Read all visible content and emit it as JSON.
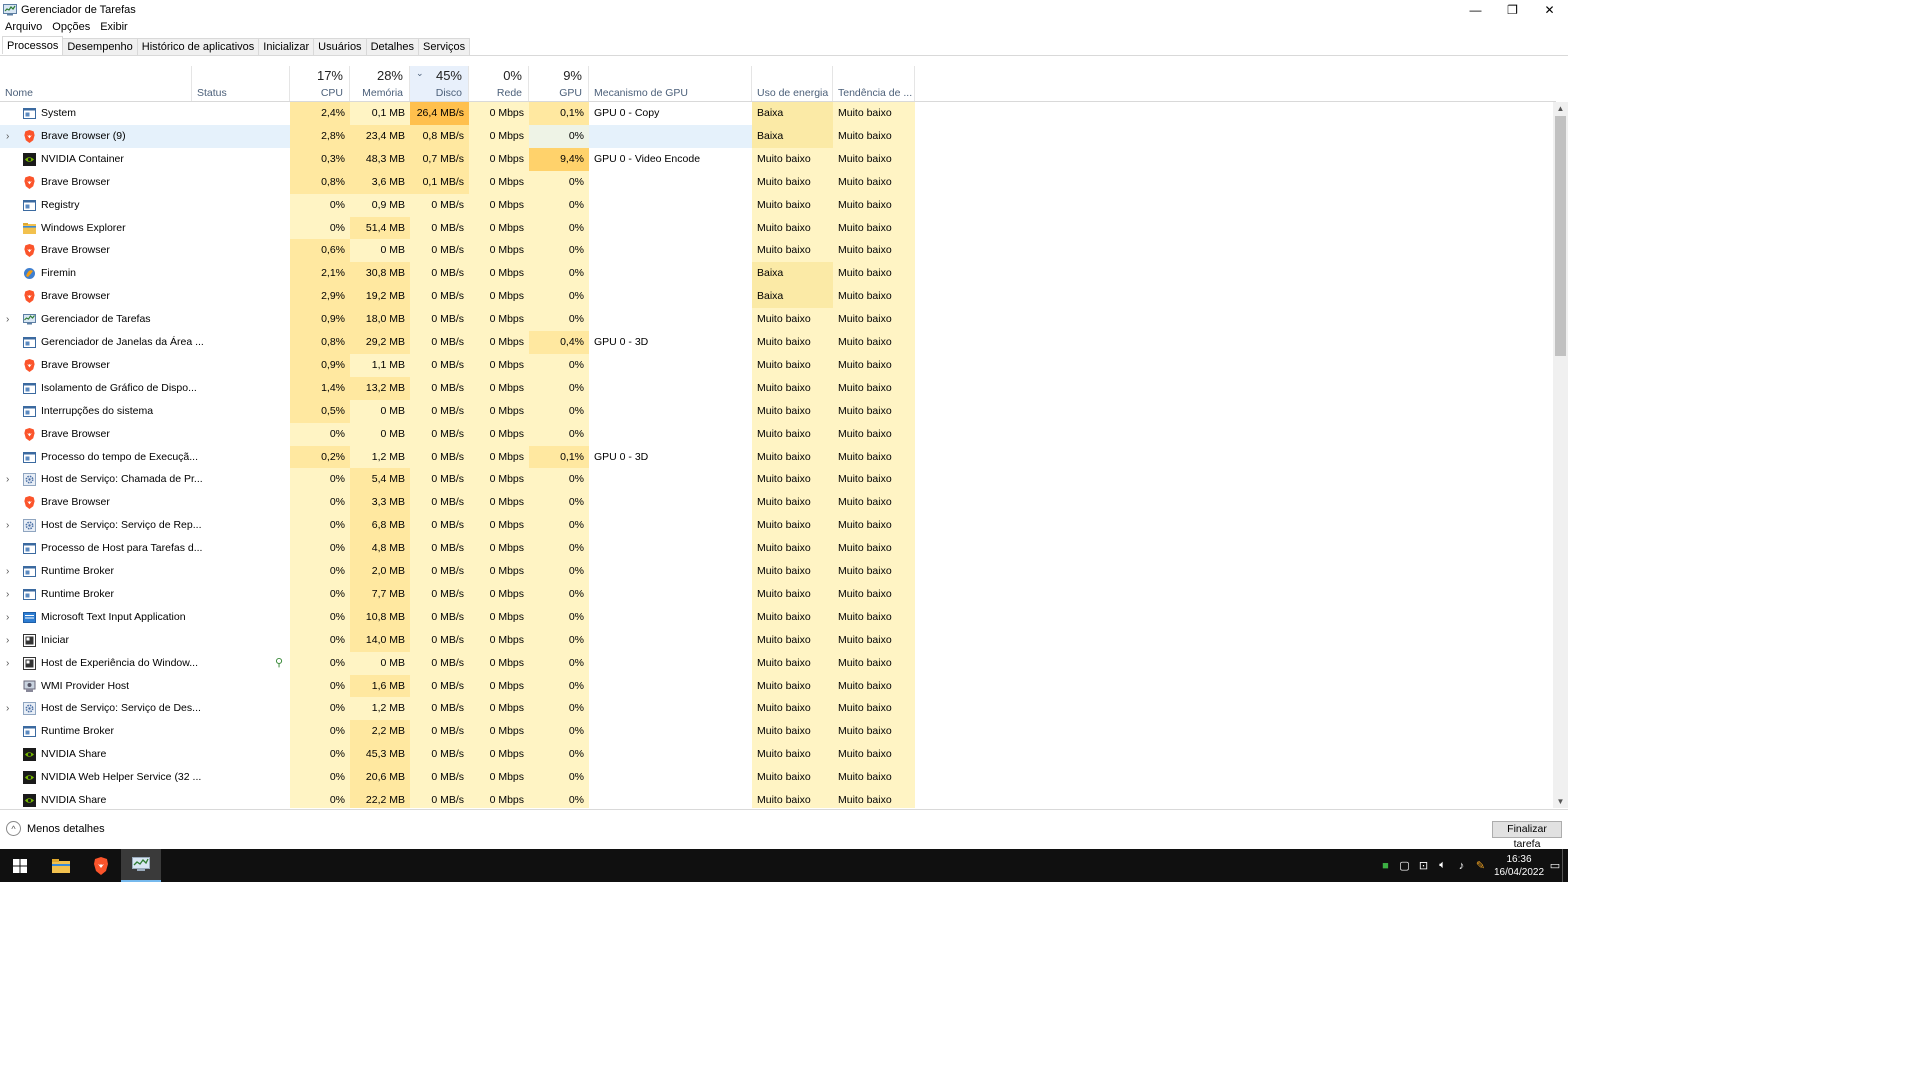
{
  "window": {
    "title": "Gerenciador de Tarefas",
    "minimize": "—",
    "restore": "❐",
    "close": "✕"
  },
  "menu": [
    "Arquivo",
    "Opções",
    "Exibir"
  ],
  "tabs": [
    "Processos",
    "Desempenho",
    "Histórico de aplicativos",
    "Inicializar",
    "Usuários",
    "Detalhes",
    "Serviços"
  ],
  "header": {
    "name": "Nome",
    "status": "Status",
    "cpu_pct": "17%",
    "cpu": "CPU",
    "mem_pct": "28%",
    "mem": "Memória",
    "disk_pct": "45%",
    "disk": "Disco",
    "net_pct": "0%",
    "net": "Rede",
    "gpu_pct": "9%",
    "gpu": "GPU",
    "gpu_engine": "Mecanismo de GPU",
    "power": "Uso de energia",
    "power_trend": "Tendência de ..."
  },
  "rows": [
    {
      "name": "System",
      "icon": "system-icon",
      "exp": false,
      "cpu": "2,4%",
      "mem": "0,1 MB",
      "disk": "26,4 MB/s",
      "net": "0 Mbps",
      "gpu": "0,1%",
      "eng": "GPU 0 - Copy",
      "pow": "Baixa",
      "trend": "Muito baixo"
    },
    {
      "name": "Brave Browser (9)",
      "icon": "brave-icon",
      "exp": true,
      "cpu": "2,8%",
      "mem": "23,4 MB",
      "disk": "0,8 MB/s",
      "net": "0 Mbps",
      "gpu": "0%",
      "eng": "",
      "pow": "Baixa",
      "trend": "Muito baixo"
    },
    {
      "name": "NVIDIA Container",
      "icon": "nvidia-icon",
      "exp": false,
      "cpu": "0,3%",
      "mem": "48,3 MB",
      "disk": "0,7 MB/s",
      "net": "0 Mbps",
      "gpu": "9,4%",
      "eng": "GPU 0 - Video Encode",
      "pow": "Muito baixo",
      "trend": "Muito baixo"
    },
    {
      "name": "Brave Browser",
      "icon": "brave-icon",
      "exp": false,
      "cpu": "0,8%",
      "mem": "3,6 MB",
      "disk": "0,1 MB/s",
      "net": "0 Mbps",
      "gpu": "0%",
      "eng": "",
      "pow": "Muito baixo",
      "trend": "Muito baixo"
    },
    {
      "name": "Registry",
      "icon": "system-icon",
      "exp": false,
      "cpu": "0%",
      "mem": "0,9 MB",
      "disk": "0 MB/s",
      "net": "0 Mbps",
      "gpu": "0%",
      "eng": "",
      "pow": "Muito baixo",
      "trend": "Muito baixo"
    },
    {
      "name": "Windows Explorer",
      "icon": "explorer-icon",
      "exp": false,
      "cpu": "0%",
      "mem": "51,4 MB",
      "disk": "0 MB/s",
      "net": "0 Mbps",
      "gpu": "0%",
      "eng": "",
      "pow": "Muito baixo",
      "trend": "Muito baixo"
    },
    {
      "name": "Brave Browser",
      "icon": "brave-icon",
      "exp": false,
      "cpu": "0,6%",
      "mem": "0 MB",
      "disk": "0 MB/s",
      "net": "0 Mbps",
      "gpu": "0%",
      "eng": "",
      "pow": "Muito baixo",
      "trend": "Muito baixo"
    },
    {
      "name": "Firemin",
      "icon": "firemin-icon",
      "exp": false,
      "cpu": "2,1%",
      "mem": "30,8 MB",
      "disk": "0 MB/s",
      "net": "0 Mbps",
      "gpu": "0%",
      "eng": "",
      "pow": "Baixa",
      "trend": "Muito baixo"
    },
    {
      "name": "Brave Browser",
      "icon": "brave-icon",
      "exp": false,
      "cpu": "2,9%",
      "mem": "19,2 MB",
      "disk": "0 MB/s",
      "net": "0 Mbps",
      "gpu": "0%",
      "eng": "",
      "pow": "Baixa",
      "trend": "Muito baixo"
    },
    {
      "name": "Gerenciador de Tarefas",
      "icon": "task-manager-icon",
      "exp": true,
      "cpu": "0,9%",
      "mem": "18,0 MB",
      "disk": "0 MB/s",
      "net": "0 Mbps",
      "gpu": "0%",
      "eng": "",
      "pow": "Muito baixo",
      "trend": "Muito baixo"
    },
    {
      "name": "Gerenciador de Janelas da Área ...",
      "icon": "system-icon",
      "exp": false,
      "cpu": "0,8%",
      "mem": "29,2 MB",
      "disk": "0 MB/s",
      "net": "0 Mbps",
      "gpu": "0,4%",
      "eng": "GPU 0 - 3D",
      "pow": "Muito baixo",
      "trend": "Muito baixo"
    },
    {
      "name": "Brave Browser",
      "icon": "brave-icon",
      "exp": false,
      "cpu": "0,9%",
      "mem": "1,1 MB",
      "disk": "0 MB/s",
      "net": "0 Mbps",
      "gpu": "0%",
      "eng": "",
      "pow": "Muito baixo",
      "trend": "Muito baixo"
    },
    {
      "name": "Isolamento de Gráfico de Dispo...",
      "icon": "system-icon",
      "exp": false,
      "cpu": "1,4%",
      "mem": "13,2 MB",
      "disk": "0 MB/s",
      "net": "0 Mbps",
      "gpu": "0%",
      "eng": "",
      "pow": "Muito baixo",
      "trend": "Muito baixo"
    },
    {
      "name": "Interrupções do sistema",
      "icon": "system-icon",
      "exp": false,
      "cpu": "0,5%",
      "mem": "0 MB",
      "disk": "0 MB/s",
      "net": "0 Mbps",
      "gpu": "0%",
      "eng": "",
      "pow": "Muito baixo",
      "trend": "Muito baixo"
    },
    {
      "name": "Brave Browser",
      "icon": "brave-icon",
      "exp": false,
      "cpu": "0%",
      "mem": "0 MB",
      "disk": "0 MB/s",
      "net": "0 Mbps",
      "gpu": "0%",
      "eng": "",
      "pow": "Muito baixo",
      "trend": "Muito baixo"
    },
    {
      "name": "Processo do tempo de Execuçã...",
      "icon": "system-icon",
      "exp": false,
      "cpu": "0,2%",
      "mem": "1,2 MB",
      "disk": "0 MB/s",
      "net": "0 Mbps",
      "gpu": "0,1%",
      "eng": "GPU 0 - 3D",
      "pow": "Muito baixo",
      "trend": "Muito baixo"
    },
    {
      "name": "Host de Serviço: Chamada de Pr...",
      "icon": "gear-icon",
      "exp": true,
      "cpu": "0%",
      "mem": "5,4 MB",
      "disk": "0 MB/s",
      "net": "0 Mbps",
      "gpu": "0%",
      "eng": "",
      "pow": "Muito baixo",
      "trend": "Muito baixo"
    },
    {
      "name": "Brave Browser",
      "icon": "brave-icon",
      "exp": false,
      "cpu": "0%",
      "mem": "3,3 MB",
      "disk": "0 MB/s",
      "net": "0 Mbps",
      "gpu": "0%",
      "eng": "",
      "pow": "Muito baixo",
      "trend": "Muito baixo"
    },
    {
      "name": "Host de Serviço: Serviço de Rep...",
      "icon": "gear-icon",
      "exp": true,
      "cpu": "0%",
      "mem": "6,8 MB",
      "disk": "0 MB/s",
      "net": "0 Mbps",
      "gpu": "0%",
      "eng": "",
      "pow": "Muito baixo",
      "trend": "Muito baixo"
    },
    {
      "name": "Processo de Host para Tarefas d...",
      "icon": "system-icon",
      "exp": false,
      "cpu": "0%",
      "mem": "4,8 MB",
      "disk": "0 MB/s",
      "net": "0 Mbps",
      "gpu": "0%",
      "eng": "",
      "pow": "Muito baixo",
      "trend": "Muito baixo"
    },
    {
      "name": "Runtime Broker",
      "icon": "system-icon",
      "exp": true,
      "cpu": "0%",
      "mem": "2,0 MB",
      "disk": "0 MB/s",
      "net": "0 Mbps",
      "gpu": "0%",
      "eng": "",
      "pow": "Muito baixo",
      "trend": "Muito baixo"
    },
    {
      "name": "Runtime Broker",
      "icon": "system-icon",
      "exp": true,
      "cpu": "0%",
      "mem": "7,7 MB",
      "disk": "0 MB/s",
      "net": "0 Mbps",
      "gpu": "0%",
      "eng": "",
      "pow": "Muito baixo",
      "trend": "Muito baixo"
    },
    {
      "name": "Microsoft Text Input Application",
      "icon": "text-input-icon",
      "exp": true,
      "cpu": "0%",
      "mem": "10,8 MB",
      "disk": "0 MB/s",
      "net": "0 Mbps",
      "gpu": "0%",
      "eng": "",
      "pow": "Muito baixo",
      "trend": "Muito baixo"
    },
    {
      "name": "Iniciar",
      "icon": "start-icon",
      "exp": true,
      "cpu": "0%",
      "mem": "14,0 MB",
      "disk": "0 MB/s",
      "net": "0 Mbps",
      "gpu": "0%",
      "eng": "",
      "pow": "Muito baixo",
      "trend": "Muito baixo"
    },
    {
      "name": "Host de Experiência do Window...",
      "icon": "start-icon",
      "exp": true,
      "cpu": "0%",
      "mem": "0 MB",
      "disk": "0 MB/s",
      "net": "0 Mbps",
      "gpu": "0%",
      "eng": "",
      "pow": "Muito baixo",
      "trend": "Muito baixo",
      "leaf": true
    },
    {
      "name": "WMI Provider Host",
      "icon": "wmi-icon",
      "exp": false,
      "cpu": "0%",
      "mem": "1,6 MB",
      "disk": "0 MB/s",
      "net": "0 Mbps",
      "gpu": "0%",
      "eng": "",
      "pow": "Muito baixo",
      "trend": "Muito baixo"
    },
    {
      "name": "Host de Serviço: Serviço de Des...",
      "icon": "gear-icon",
      "exp": true,
      "cpu": "0%",
      "mem": "1,2 MB",
      "disk": "0 MB/s",
      "net": "0 Mbps",
      "gpu": "0%",
      "eng": "",
      "pow": "Muito baixo",
      "trend": "Muito baixo"
    },
    {
      "name": "Runtime Broker",
      "icon": "system-icon",
      "exp": false,
      "cpu": "0%",
      "mem": "2,2 MB",
      "disk": "0 MB/s",
      "net": "0 Mbps",
      "gpu": "0%",
      "eng": "",
      "pow": "Muito baixo",
      "trend": "Muito baixo"
    },
    {
      "name": "NVIDIA Share",
      "icon": "nvidia-icon",
      "exp": false,
      "cpu": "0%",
      "mem": "45,3 MB",
      "disk": "0 MB/s",
      "net": "0 Mbps",
      "gpu": "0%",
      "eng": "",
      "pow": "Muito baixo",
      "trend": "Muito baixo"
    },
    {
      "name": "NVIDIA Web Helper Service (32 ...",
      "icon": "nvidia-icon",
      "exp": false,
      "cpu": "0%",
      "mem": "20,6 MB",
      "disk": "0 MB/s",
      "net": "0 Mbps",
      "gpu": "0%",
      "eng": "",
      "pow": "Muito baixo",
      "trend": "Muito baixo"
    },
    {
      "name": "NVIDIA Share",
      "icon": "nvidia-icon",
      "exp": false,
      "cpu": "0%",
      "mem": "22,2 MB",
      "disk": "0 MB/s",
      "net": "0 Mbps",
      "gpu": "0%",
      "eng": "",
      "pow": "Muito baixo",
      "trend": "Muito baixo"
    }
  ],
  "footer": {
    "less_details": "Menos detalhes",
    "end_task": "Finalizar tarefa"
  },
  "taskbar": {
    "time": "16:36",
    "date": "16/04/2022"
  },
  "colors": {
    "heat_light": "#fff4c4",
    "heat_mid": "#ffe8a0",
    "heat_high": "#ffd26b",
    "heat_disk_high": "#ffc04d",
    "row_hover": "#e5f1fb",
    "power_low": "#fbeaa6"
  }
}
